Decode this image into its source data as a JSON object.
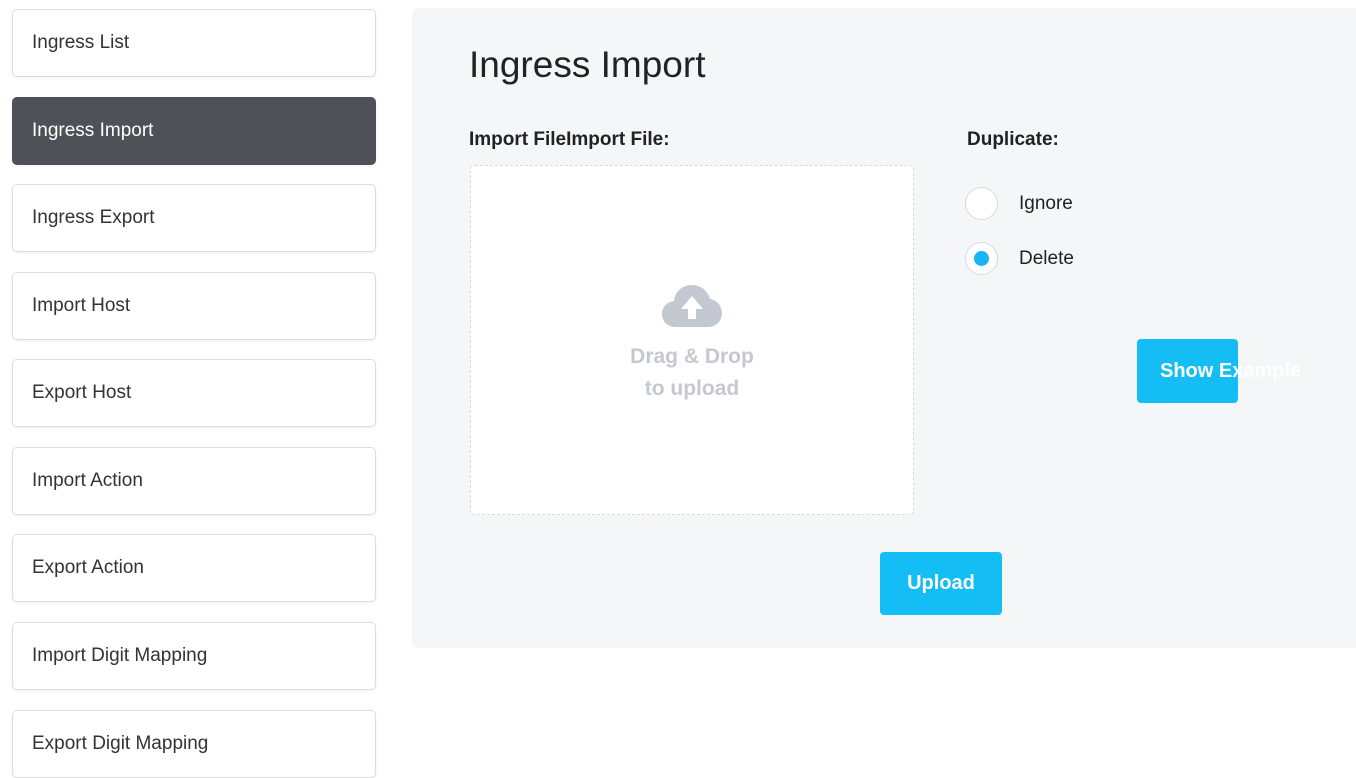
{
  "sidebar": {
    "items": [
      {
        "label": "Ingress List"
      },
      {
        "label": "Ingress Import"
      },
      {
        "label": "Ingress Export"
      },
      {
        "label": "Import Host"
      },
      {
        "label": "Export Host"
      },
      {
        "label": "Import Action"
      },
      {
        "label": "Export Action"
      },
      {
        "label": "Import Digit Mapping"
      },
      {
        "label": "Export Digit Mapping"
      }
    ],
    "active_index": 1
  },
  "main": {
    "title": "Ingress Import",
    "import_file_label": "Import FileImport File:",
    "dropzone": {
      "icon": "cloud-upload-icon",
      "line1": "Drag & Drop",
      "line2": "to upload"
    },
    "duplicate_label": "Duplicate:",
    "duplicate_options": [
      {
        "label": "Ignore",
        "checked": false
      },
      {
        "label": "Delete",
        "checked": true
      }
    ],
    "show_example_label": "Show Example",
    "upload_label": "Upload"
  },
  "colors": {
    "accent": "#14bef5",
    "active_nav": "#4e5157",
    "panel_bg": "#f5f6f8",
    "dropzone_text": "#c3c8d1"
  }
}
